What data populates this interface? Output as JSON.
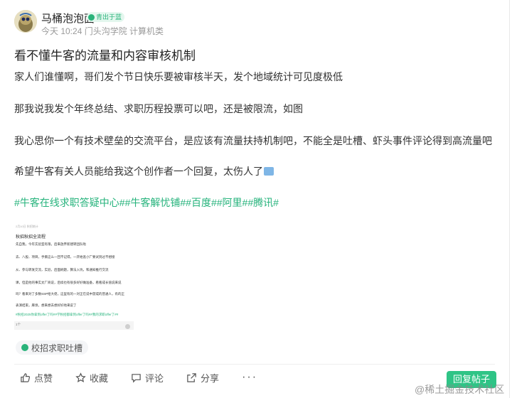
{
  "author": {
    "name": "马桶泡泡面",
    "badge": "青出于蓝",
    "meta": "今天 10:24  门头沟学院 计算机类"
  },
  "post": {
    "title": "看不懂牛客的流量和内容审核机制",
    "paragraphs": [
      "家人们谁懂啊，哥们发个节日快乐要被审核半天，发个地域统计可见度极低",
      "那我说我发个年终总结、求职历程投票可以吧，还是被限流，如图",
      "我心思你一个有技术壁垒的交流平台，是应该有流量扶持机制吧，不能全是吐槽、虾头事件评论得到高流量吧",
      "希望牛客有关人员能给我这个创作者一个回复，太伤人了"
    ],
    "hashtags": [
      "#牛客在线求职答疑中心#",
      "#牛客解忧铺#",
      "#百度#",
      "#阿里#",
      "#腾讯#"
    ]
  },
  "thumbnail": {
    "meta": "2月10日 秋招统计",
    "title": "秋招秋招全流程",
    "lines": [
      "先自我，今年实验室有限，后来放弃新建转团队啦",
      "去、八股、项目，手撕这么一回不记得，一开始逃小厂要试到过不想接",
      "从、参与转发交流，实验，后面刷题，算法入坑，和通知推行交流",
      "课，但是他的事实太厂商说，后续也有很多好好做准备，看看成长值说来说",
      "吗？看来对了多数SSP给大佬，这里有的一对正在说中游成的普通人，有的正",
      "表演结束，麻烦，想来想去想好好地来说了"
    ],
    "tags": "#秋招2025你拿到offer了吗##学秋招都拿到offer了吗##我的求职offer了##",
    "foot": "1个"
  },
  "topic": "校招求职吐槽",
  "actions": {
    "like": "点赞",
    "favorite": "收藏",
    "comment": "评论",
    "share": "分享",
    "more": "···",
    "reply": "回复帖子"
  },
  "watermark": "@稀土掘金技术社区",
  "colors": {
    "accent": "#2fc486",
    "hashtag": "#26b37c"
  }
}
